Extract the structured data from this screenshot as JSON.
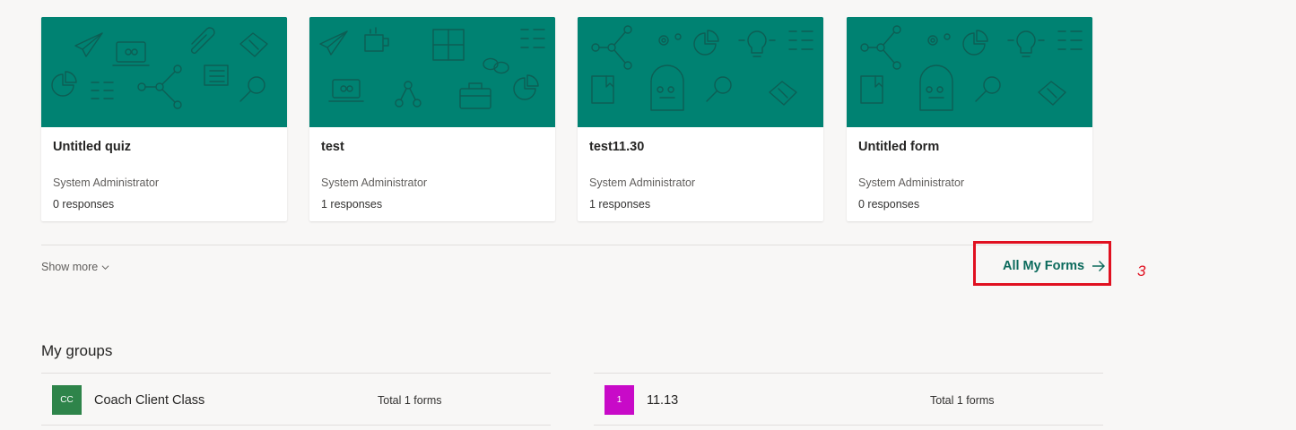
{
  "recent_forms": [
    {
      "title": "Untitled quiz",
      "owner": "System Administrator",
      "responses": "0 responses"
    },
    {
      "title": "test",
      "owner": "System Administrator",
      "responses": "1 responses"
    },
    {
      "title": "test11.30",
      "owner": "System Administrator",
      "responses": "1 responses"
    },
    {
      "title": "Untitled form",
      "owner": "System Administrator",
      "responses": "0 responses"
    }
  ],
  "thumbnail_color": "#008272",
  "show_more_label": "Show more",
  "all_forms_label": "All My Forms",
  "annotation": {
    "step": "3",
    "color": "#e01020"
  },
  "groups_section": {
    "title": "My groups",
    "groups": [
      {
        "initials": "CC",
        "name": "Coach Client Class",
        "count": "Total 1 forms",
        "color": "#2e844a"
      },
      {
        "initials": "1",
        "name": "11.13",
        "count": "Total 1 forms",
        "color": "#c80ac8"
      }
    ]
  }
}
